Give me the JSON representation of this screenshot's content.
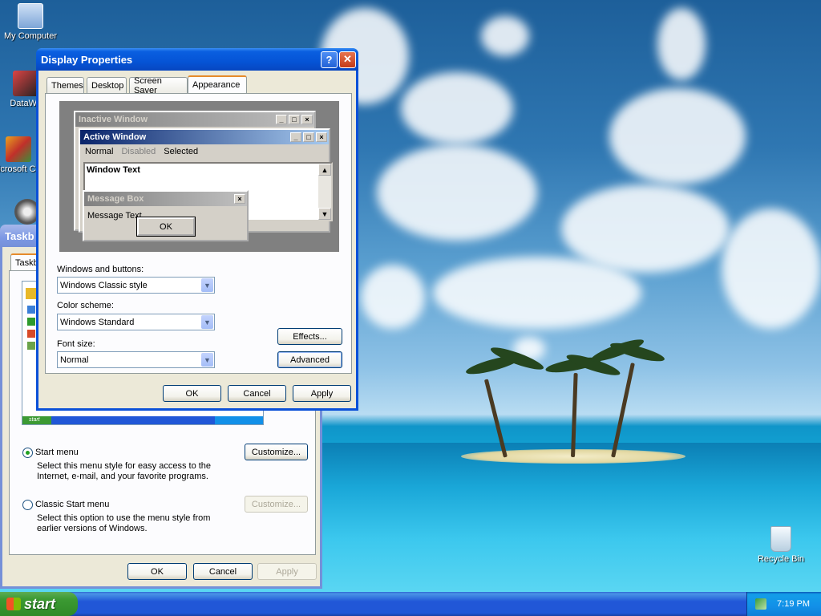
{
  "desktop": {
    "icons": [
      {
        "label": "My Computer"
      },
      {
        "label": "DataWa"
      },
      {
        "label": "Microsoft C++"
      },
      {
        "label": "Recycle Bin"
      }
    ]
  },
  "taskbar_window": {
    "title": "Taskb",
    "tab_label": "Taskb",
    "preview_start": "start",
    "start_menu_label": "Start menu",
    "start_menu_desc1": "Select this menu style for easy access to the",
    "start_menu_desc2": "Internet, e-mail, and your favorite programs.",
    "classic_label": "Classic Start menu",
    "classic_desc1": "Select this option to use the menu style from",
    "classic_desc2": "earlier versions of Windows.",
    "customize_label": "Customize...",
    "customize_disabled_label": "Customize...",
    "ok_label": "OK",
    "cancel_label": "Cancel",
    "apply_label": "Apply"
  },
  "display_window": {
    "title": "Display Properties",
    "help_label": "?",
    "close_label": "✕",
    "tabs": [
      {
        "label": "Themes"
      },
      {
        "label": "Desktop"
      },
      {
        "label": "Screen Saver"
      },
      {
        "label": "Appearance"
      }
    ],
    "preview": {
      "inactive_title": "Inactive Window",
      "active_title": "Active Window",
      "menu_normal": "Normal",
      "menu_disabled": "Disabled",
      "menu_selected": "Selected",
      "window_text": "Window Text",
      "msgbox_title": "Message Box",
      "msgbox_text": "Message Text",
      "msgbox_ok": "OK"
    },
    "windows_buttons_label": "Windows and buttons:",
    "windows_buttons_value": "Windows Classic style",
    "color_scheme_label": "Color scheme:",
    "color_scheme_value": "Windows Standard",
    "font_size_label": "Font size:",
    "font_size_value": "Normal",
    "effects_label": "Effects...",
    "advanced_label": "Advanced",
    "ok_label": "OK",
    "cancel_label": "Cancel",
    "apply_label": "Apply"
  },
  "taskbar": {
    "start_label": "start",
    "clock": "7:19 PM"
  },
  "colors": {
    "title_active": "#0554d6",
    "classic_active": "#0a246a",
    "classic_inactive": "#808080"
  }
}
